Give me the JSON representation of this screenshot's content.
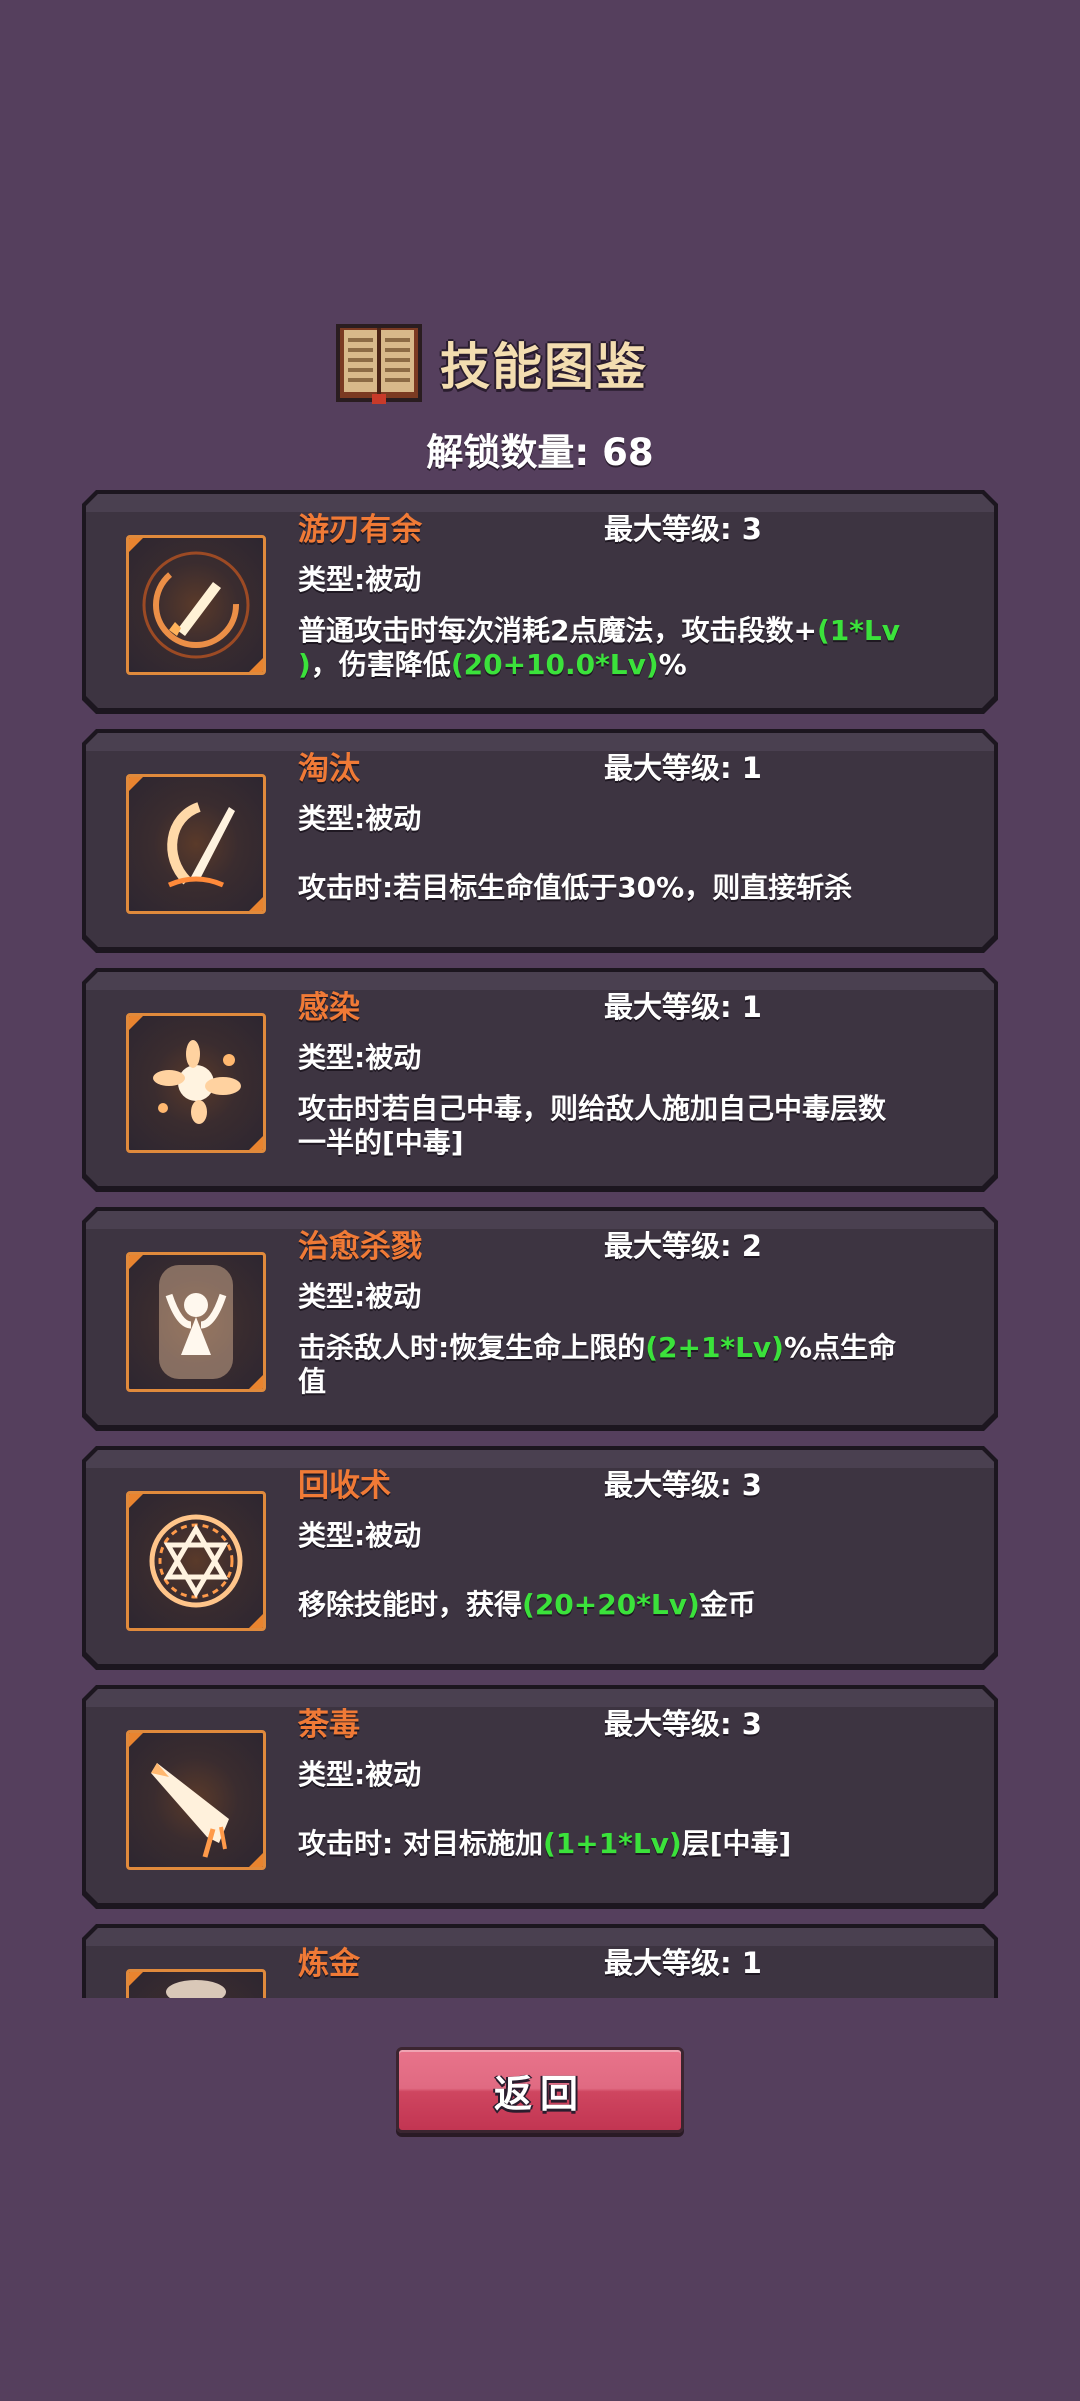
{
  "header": {
    "title": "技能图鉴",
    "book_icon": "book-icon",
    "unlock_label": "解锁数量: 68"
  },
  "skills": [
    {
      "name": "游刃有余",
      "max_level": "最大等级: 3",
      "type": "类型:被动",
      "icon": "sword-swirl-icon",
      "desc_line1_a": "普通攻击时每次消耗2点魔法，攻击段数+",
      "desc_line1_hl": "(1*Lv",
      "desc_line2_hl": ")",
      "desc_line2_b": "，伤害降低",
      "desc_line2_hl2": "(20+10.0*Lv)",
      "desc_line2_c": "%"
    },
    {
      "name": "淘汰",
      "max_level": "最大等级: 1",
      "type": "类型:被动",
      "icon": "execute-slash-icon",
      "desc": "攻击时:若目标生命值低于30%，则直接斩杀"
    },
    {
      "name": "感染",
      "max_level": "最大等级: 1",
      "type": "类型:被动",
      "icon": "poison-splash-icon",
      "desc_line1": "攻击时若自己中毒，则给敌人施加自己中毒层数",
      "desc_line2": "一半的[中毒]"
    },
    {
      "name": "治愈杀戮",
      "max_level": "最大等级: 2",
      "type": "类型:被动",
      "icon": "healing-figure-icon",
      "desc_line1_a": "击杀敌人时:恢复生命上限的",
      "desc_line1_hl": "(2+1*Lv)",
      "desc_line1_b": "%点生命",
      "desc_line2": "值"
    },
    {
      "name": "回收术",
      "max_level": "最大等级: 3",
      "type": "类型:被动",
      "icon": "hexagram-circle-icon",
      "desc_a": "移除技能时，获得",
      "desc_hl": "(20+20*Lv)",
      "desc_b": "金币"
    },
    {
      "name": "荼毒",
      "max_level": "最大等级: 3",
      "type": "类型:被动",
      "icon": "poison-blade-icon",
      "desc_a": "攻击时: 对目标施加",
      "desc_hl": "(1+1*Lv)",
      "desc_b": "层[中毒]"
    },
    {
      "name": "炼金",
      "max_level": "最大等级: 1",
      "icon": "alchemy-icon"
    }
  ],
  "back_button": {
    "label": "返回"
  },
  "colors": {
    "background": "#553f5d",
    "card": "#3d3441",
    "name": "#f07a36",
    "highlight": "#3be23b",
    "button": "#d9546d"
  }
}
